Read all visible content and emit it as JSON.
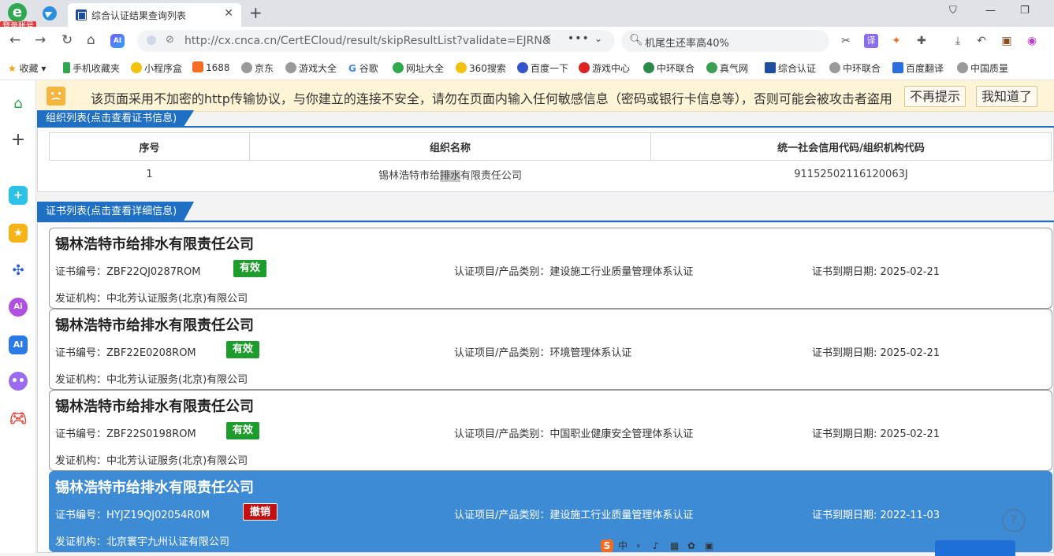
{
  "browser": {
    "login_badge": "登录账号",
    "tab_title": "综合认证结果查询列表",
    "url": "http://cx.cnca.cn/CertECloud/result/skipResultList?validate=EJRN&",
    "search_text": "机尾生还率高40%",
    "bookmarks": [
      "收藏",
      "手机收藏夹",
      "小程序盒",
      "1688",
      "京东",
      "游戏大全",
      "谷歌",
      "网址大全",
      "360搜索",
      "百度一下",
      "游戏中心",
      "中环联合",
      "真气网",
      "综合认证",
      "中环联合",
      "百度翻译",
      "中国质量"
    ]
  },
  "warning": {
    "message": "该页面采用不加密的http传输协议，与你建立的连接不安全，请勿在页面内输入任何敏感信息（密码或银行卡信息等），否则可能会被攻击者盗用",
    "no_remind": "不再提示",
    "got_it": "我知道了"
  },
  "org_section": {
    "header": "组织列表(点击查看证书信息)",
    "columns": [
      "序号",
      "组织名称",
      "统一社会信用代码/组织机构代码"
    ],
    "rows": [
      {
        "index": "1",
        "name_pre": "锡林浩特市给",
        "name_hl": "排水",
        "name_post": "有限责任公司",
        "code": "91152502116120063J"
      }
    ]
  },
  "cert_section": {
    "header": "证书列表(点击查看详细信息)",
    "labels": {
      "cert_no": "证书编号：",
      "project": "认证项目/产品类别：",
      "expiry": "证书到期日期: ",
      "issuer": "发证机构："
    },
    "cards": [
      {
        "company": "锡林浩特市给排水有限责任公司",
        "cert_no": "ZBF22QJ0287ROM",
        "status": "有效",
        "project": "建设施工行业质量管理体系认证",
        "expiry": "2025-02-21",
        "issuer": "中北芳认证服务(北京)有限公司"
      },
      {
        "company": "锡林浩特市给排水有限责任公司",
        "cert_no": "ZBF22E0208ROM",
        "status": "有效",
        "project": "环境管理体系认证",
        "expiry": "2025-02-21",
        "issuer": "中北芳认证服务(北京)有限公司"
      },
      {
        "company": "锡林浩特市给排水有限责任公司",
        "cert_no": "ZBF22S0198ROM",
        "status": "有效",
        "project": "中国职业健康安全管理体系认证",
        "expiry": "2025-02-21",
        "issuer": "中北芳认证服务(北京)有限公司"
      },
      {
        "company": "锡林浩特市给排水有限责任公司",
        "cert_no": "HYJZ19QJ02054R0M",
        "status": "撤销",
        "project": "建设施工行业质量管理体系认证",
        "expiry": "2022-11-03",
        "issuer": "北京寰宇九州认证有限公司"
      }
    ]
  },
  "colors": {
    "accent": "#1f6fc5",
    "valid": "#1e9c2c",
    "revoked": "#c41010",
    "selected_card": "#3d8bd5"
  }
}
